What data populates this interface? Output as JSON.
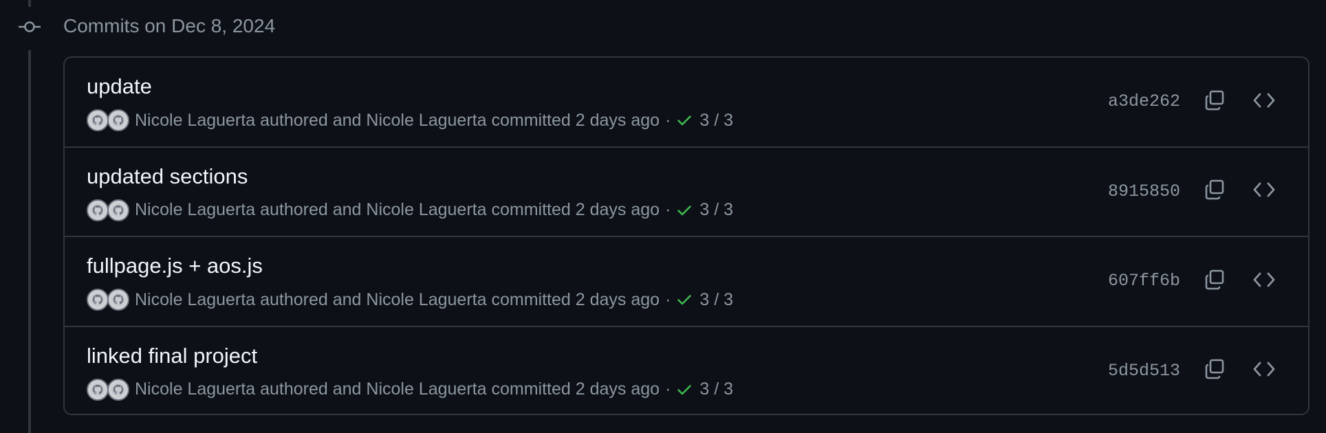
{
  "group": {
    "header": "Commits on Dec 8, 2024"
  },
  "commits": [
    {
      "title": "update",
      "author": "Nicole Laguerta",
      "authored_word": "authored and",
      "committer": "Nicole Laguerta",
      "committed_word": "committed",
      "time": "2 days ago",
      "separator": "·",
      "checks": "3 / 3",
      "sha": "a3de262"
    },
    {
      "title": "updated sections",
      "author": "Nicole Laguerta",
      "authored_word": "authored and",
      "committer": "Nicole Laguerta",
      "committed_word": "committed",
      "time": "2 days ago",
      "separator": "·",
      "checks": "3 / 3",
      "sha": "8915850"
    },
    {
      "title": "fullpage.js + aos.js",
      "author": "Nicole Laguerta",
      "authored_word": "authored and",
      "committer": "Nicole Laguerta",
      "committed_word": "committed",
      "time": "2 days ago",
      "separator": "·",
      "checks": "3 / 3",
      "sha": "607ff6b"
    },
    {
      "title": "linked final project",
      "author": "Nicole Laguerta",
      "authored_word": "authored and",
      "committer": "Nicole Laguerta",
      "committed_word": "committed",
      "time": "2 days ago",
      "separator": "·",
      "checks": "3 / 3",
      "sha": "5d5d513"
    }
  ],
  "icons": {
    "commit_node": "git-commit-icon",
    "avatar": "github-avatar-icon",
    "check": "check-icon",
    "copy": "copy-icon",
    "browse": "code-brackets-icon"
  },
  "colors": {
    "background": "#0d1117",
    "border": "#30363d",
    "muted_text": "#8d96a0",
    "title_text": "#f0f6fc",
    "success": "#3fb950"
  }
}
